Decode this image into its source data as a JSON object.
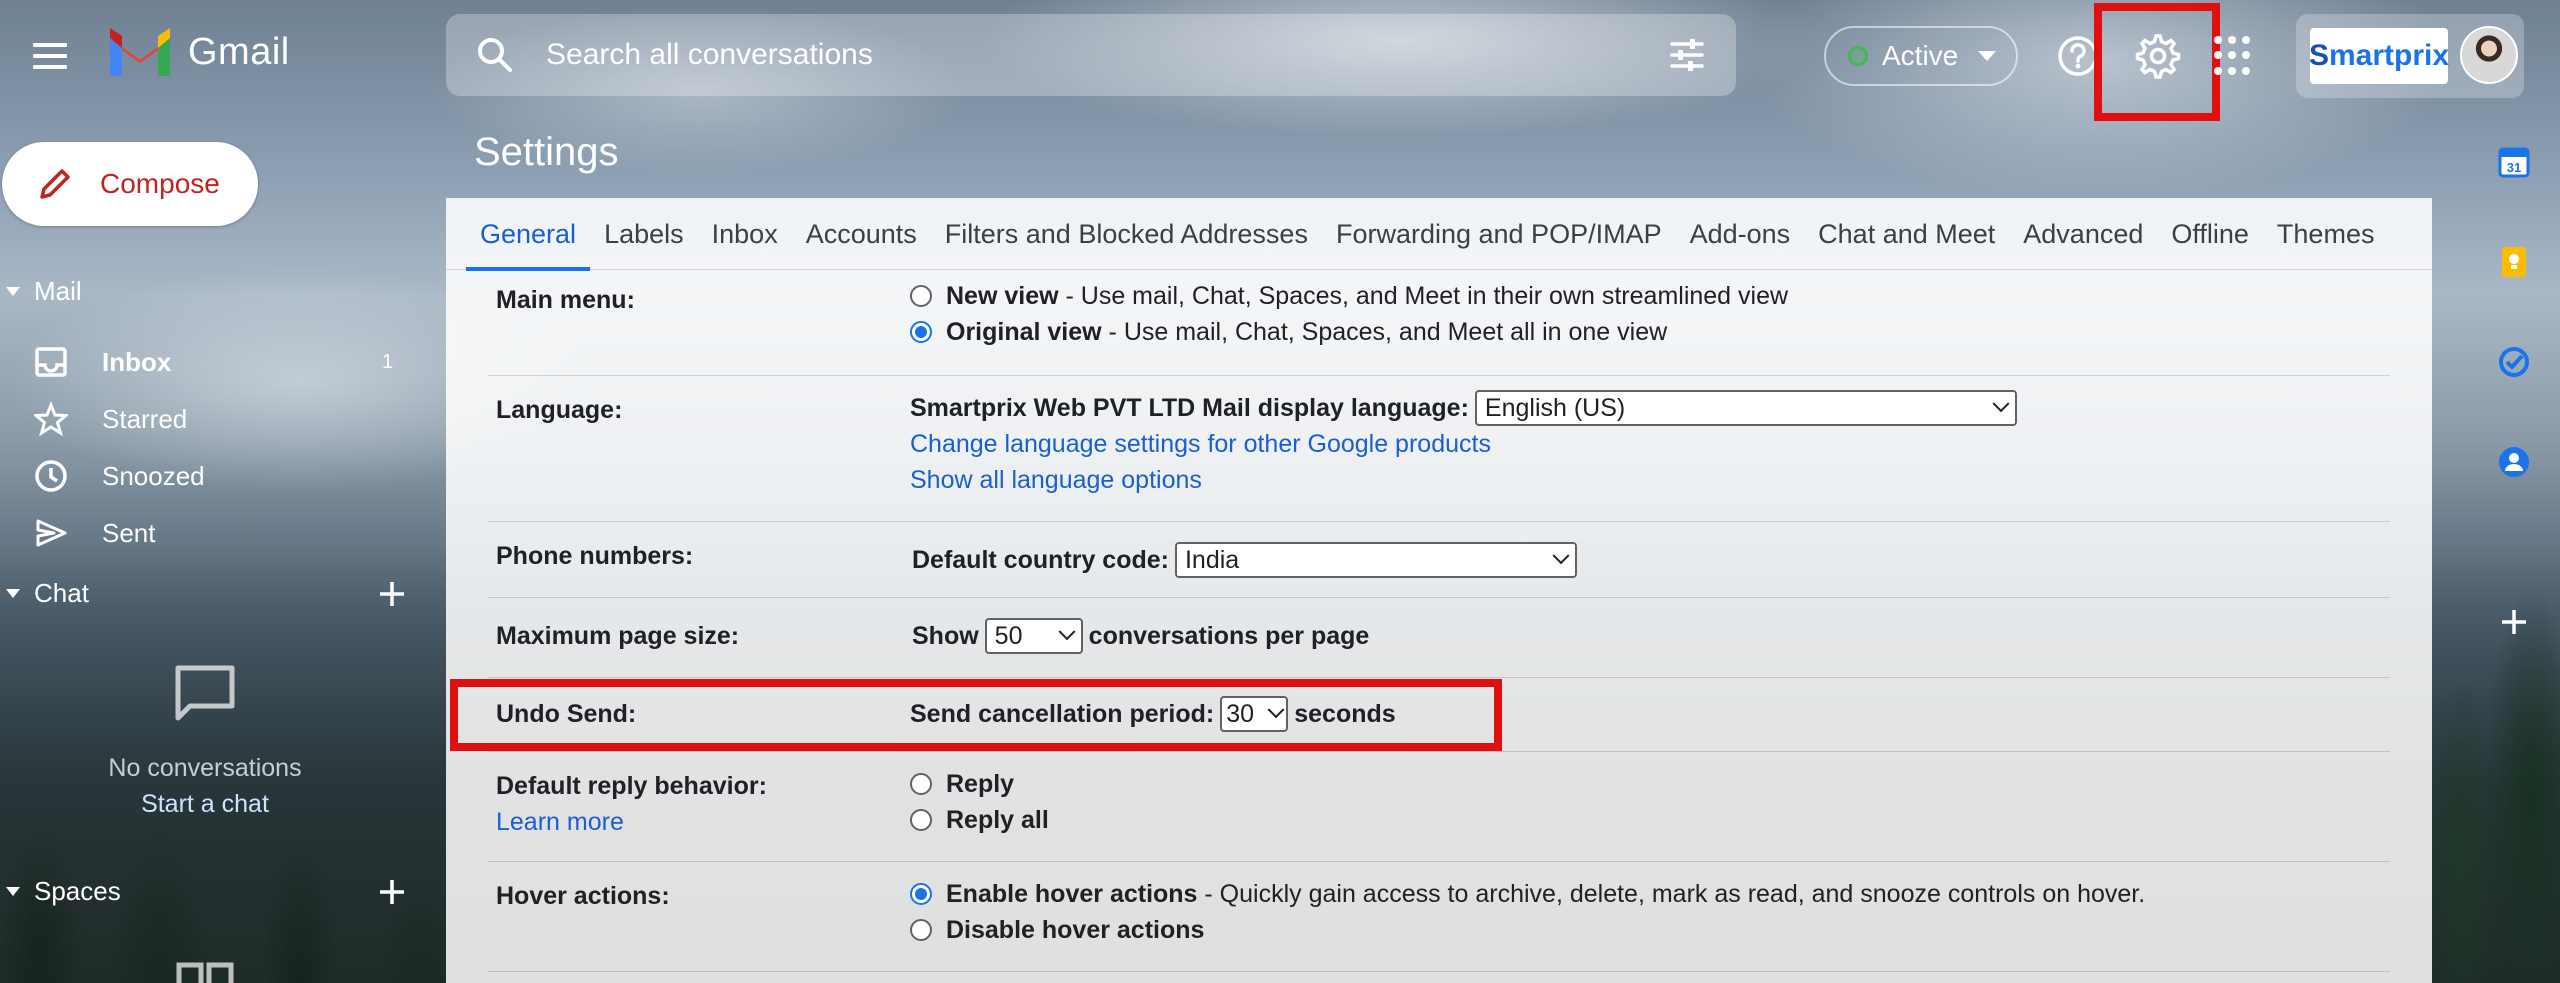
{
  "header": {
    "app_name": "Gmail",
    "search_placeholder": "Search all conversations",
    "status_label": "Active",
    "brand_text_1": "S",
    "brand_text_2": "martprix"
  },
  "nav": {
    "compose_label": "Compose",
    "mail_section": "Mail",
    "items": [
      {
        "label": "Inbox",
        "count": "1",
        "icon": "inbox-icon"
      },
      {
        "label": "Starred",
        "icon": "star-icon"
      },
      {
        "label": "Snoozed",
        "icon": "clock-icon"
      },
      {
        "label": "Sent",
        "icon": "send-icon"
      }
    ],
    "chat_section": "Chat",
    "chat_empty": "No conversations",
    "chat_link": "Start a chat",
    "spaces_section": "Spaces"
  },
  "settings": {
    "title": "Settings",
    "tabs": [
      "General",
      "Labels",
      "Inbox",
      "Accounts",
      "Filters and Blocked Addresses",
      "Forwarding and POP/IMAP",
      "Add-ons",
      "Chat and Meet",
      "Advanced",
      "Offline",
      "Themes"
    ],
    "active_tab": "General",
    "main_menu": {
      "label": "Main menu:",
      "new_view_title": "New view",
      "new_view_desc": " - Use mail, Chat, Spaces, and Meet in their own streamlined view",
      "original_view_title": "Original view",
      "original_view_desc": " - Use mail, Chat, Spaces, and Meet all in one view"
    },
    "language": {
      "label": "Language:",
      "display_label": "Smartprix Web PVT LTD Mail display language:",
      "display_value": "English (US)",
      "link_1": "Change language settings for other Google products",
      "link_2": "Show all language options"
    },
    "phone": {
      "label": "Phone numbers:",
      "country_label": "Default country code:",
      "country_value": "India"
    },
    "page_size": {
      "label": "Maximum page size:",
      "prefix": "Show",
      "value": "50",
      "suffix": "conversations per page"
    },
    "undo_send": {
      "label": "Undo Send:",
      "period_label": "Send cancellation period:",
      "value": "30",
      "suffix": "seconds"
    },
    "reply": {
      "label": "Default reply behavior:",
      "learn_more": "Learn more",
      "option_1": "Reply",
      "option_2": "Reply all"
    },
    "hover": {
      "label": "Hover actions:",
      "enable_title": "Enable hover actions",
      "enable_desc": " - Quickly gain access to archive, delete, mark as read, and snooze controls on hover.",
      "disable_title": "Disable hover actions"
    }
  },
  "colors": {
    "accent": "#1a73e8",
    "highlight_box": "#e01010",
    "compose_text": "#c5221f"
  }
}
